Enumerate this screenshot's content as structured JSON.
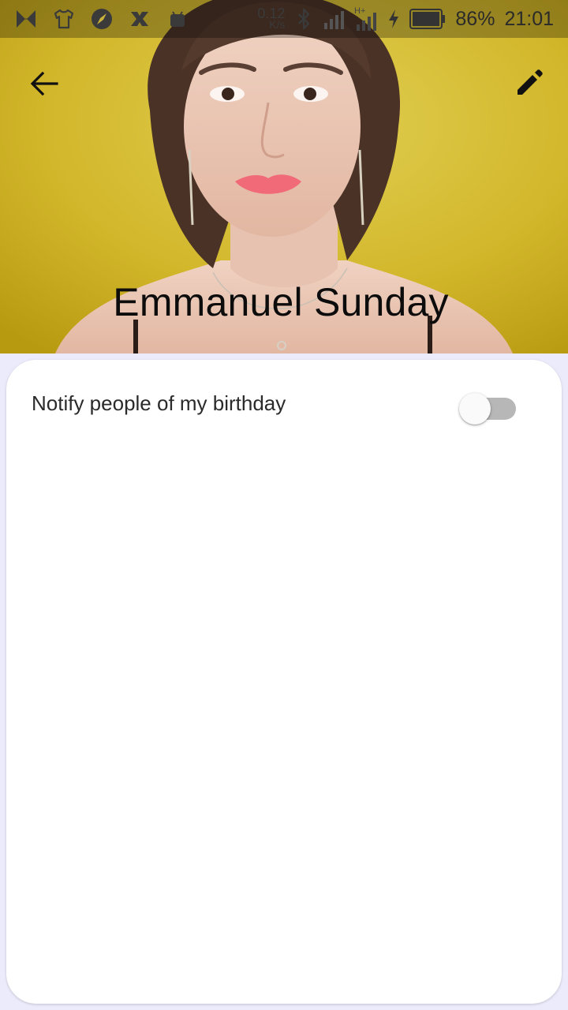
{
  "status_bar": {
    "net_speed_value": "0.12",
    "net_speed_unit": "K/s",
    "battery_percent": "86%",
    "time": "21:01",
    "icons": [
      "app-m-icon",
      "tshirt-icon",
      "compass-icon",
      "x-app-icon",
      "android-icon",
      "bluetooth-icon",
      "signal-icon",
      "signal-hplus-icon",
      "charging-icon",
      "battery-icon"
    ]
  },
  "app_bar": {
    "back_icon": "arrow-back-icon",
    "edit_icon": "pencil-icon"
  },
  "profile": {
    "name": "Emmanuel Sunday"
  },
  "settings": {
    "birthday_notify": {
      "label": "Notify people of my birthday",
      "enabled": false
    }
  },
  "colors": {
    "header_bg": "#d2b62a",
    "page_bg": "#ebebfb",
    "card_bg": "#ffffff",
    "toggle_track_off": "#b7b7b7",
    "toggle_thumb": "#fafafa"
  }
}
